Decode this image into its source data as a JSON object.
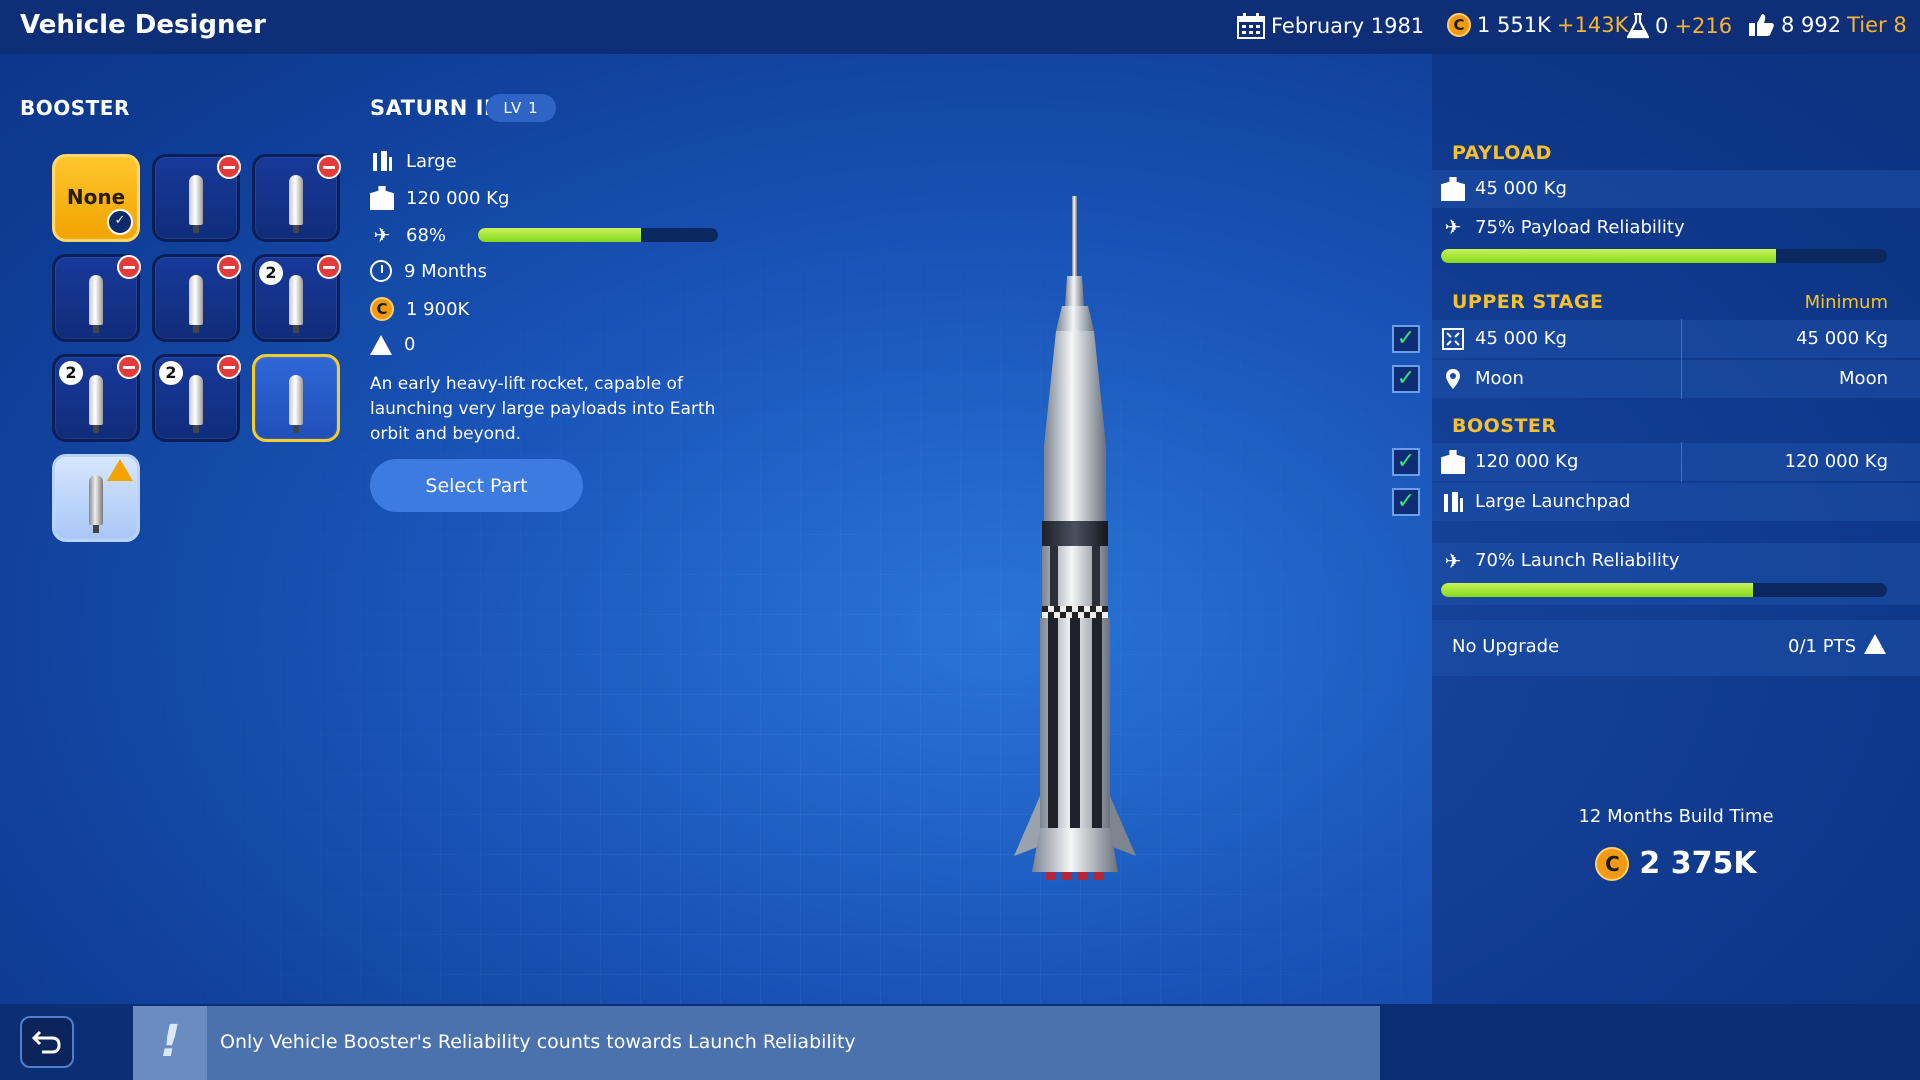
{
  "header": {
    "title": "Vehicle Designer",
    "date": "February 1981",
    "money": "1 551K",
    "money_delta": "+143K",
    "science": "0",
    "science_delta": "+216",
    "reputation": "8 992",
    "tier": "Tier 8",
    "icons": [
      "calendar-icon",
      "coin-icon",
      "flask-icon",
      "thumbs-up-icon"
    ]
  },
  "booster_panel": {
    "label": "BOOSTER",
    "none_label": "None",
    "tiles": [
      {
        "state": "none",
        "selected_indicator": "checkmark"
      },
      {
        "state": "locked"
      },
      {
        "state": "locked"
      },
      {
        "state": "locked"
      },
      {
        "state": "locked"
      },
      {
        "state": "locked",
        "count": "2"
      },
      {
        "state": "locked",
        "count": "2"
      },
      {
        "state": "locked",
        "count": "2"
      },
      {
        "state": "selected"
      },
      {
        "state": "warning"
      }
    ]
  },
  "part": {
    "name": "SATURN IB",
    "level": "LV 1",
    "size": "Large",
    "payload": "120 000 Kg",
    "reliability": "68%",
    "reliability_value": 0.68,
    "build_time": "9 Months",
    "cost": "1 900K",
    "upgrades": "0",
    "description": "An early heavy-lift rocket, capable of launching very large payloads into Earth orbit and beyond.",
    "select_label": "Select Part"
  },
  "summary": {
    "payload_header": "PAYLOAD",
    "payload_weight": "45 000 Kg",
    "payload_reliability": "75% Payload Reliability",
    "payload_reliability_value": 0.75,
    "upper_stage_header": "UPPER STAGE",
    "minimum_label": "Minimum",
    "upper_weight": "45 000 Kg",
    "upper_weight_min": "45 000 Kg",
    "upper_destination": "Moon",
    "upper_destination_min": "Moon",
    "booster_header": "BOOSTER",
    "booster_weight": "120 000 Kg",
    "booster_weight_min": "120 000 Kg",
    "booster_launchpad": "Large Launchpad",
    "launch_reliability": "70% Launch Reliability",
    "launch_reliability_value": 0.7,
    "upgrade_label": "No Upgrade",
    "upgrade_points": "0/1 PTS",
    "build_time": "12 Months Build Time",
    "total_cost": "2 375K"
  },
  "footer": {
    "tip": "Only Vehicle Booster's Reliability counts towards Launch Reliability"
  },
  "colors": {
    "accent": "#f7c02c",
    "bar_fill": "#a6e43a",
    "bar_track": "#0c2860",
    "coin": "#f29a12",
    "check": "#3de07a",
    "blocked": "#e43a3a"
  }
}
